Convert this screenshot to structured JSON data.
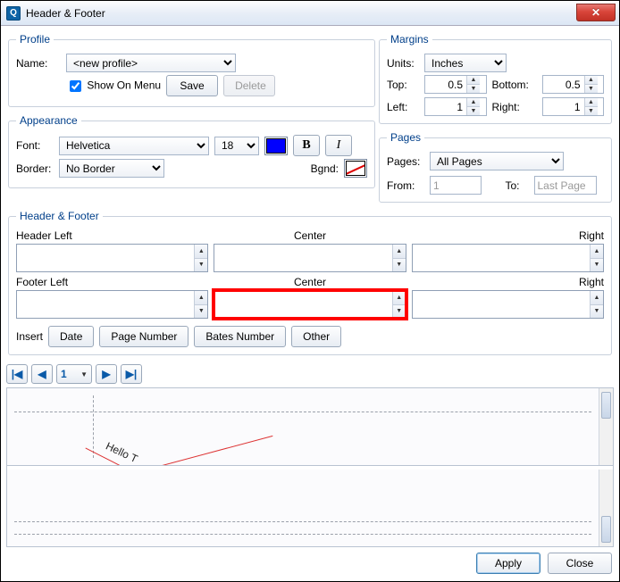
{
  "window": {
    "title": "Header & Footer"
  },
  "profile": {
    "legend": "Profile",
    "name_label": "Name:",
    "selected": "<new profile>",
    "show_on_menu": "Show On Menu",
    "save": "Save",
    "delete": "Delete"
  },
  "appearance": {
    "legend": "Appearance",
    "font_label": "Font:",
    "font": "Helvetica",
    "size": "18",
    "border_label": "Border:",
    "border": "No Border",
    "bgnd_label": "Bgnd:"
  },
  "margins": {
    "legend": "Margins",
    "units_label": "Units:",
    "units": "Inches",
    "top_label": "Top:",
    "top": "0.5",
    "bottom_label": "Bottom:",
    "bottom": "0.5",
    "left_label": "Left:",
    "left": "1",
    "right_label": "Right:",
    "right": "1"
  },
  "pages": {
    "legend": "Pages",
    "pages_label": "Pages:",
    "selection": "All Pages",
    "from_label": "From:",
    "from": "1",
    "to_label": "To:",
    "to": "Last Page"
  },
  "hf": {
    "legend": "Header & Footer",
    "header_left": "Header Left",
    "footer_left": "Footer Left",
    "center": "Center",
    "right": "Right",
    "insert": "Insert",
    "date": "Date",
    "page_number": "Page Number",
    "bates": "Bates Number",
    "other": "Other"
  },
  "pager": {
    "current": "1"
  },
  "preview": {
    "text": "Hello T"
  },
  "buttons": {
    "apply": "Apply",
    "close": "Close"
  }
}
